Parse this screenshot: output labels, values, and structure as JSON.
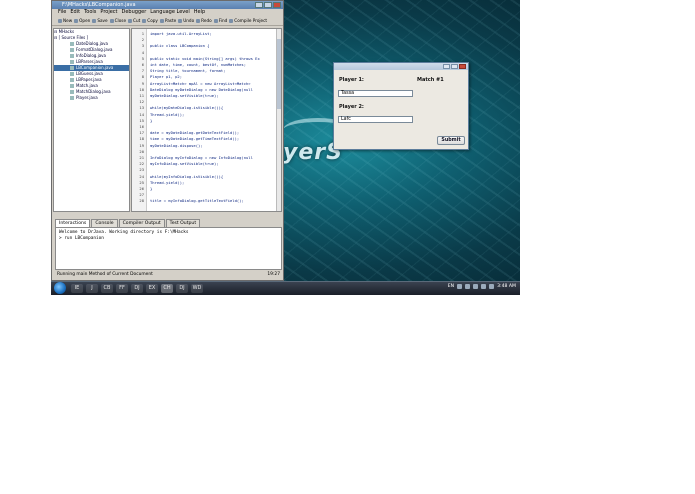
{
  "ide": {
    "title": "F:\\MHacks\\LBCompanion.java",
    "menu": [
      "File",
      "Edit",
      "Tools",
      "Project",
      "Debugger",
      "Language Level",
      "Help"
    ],
    "toolbar": [
      "New",
      "Open",
      "Save",
      "Close",
      "Cut",
      "Copy",
      "Paste",
      "Undo",
      "Redo",
      "Find",
      "Compile Project"
    ],
    "tree": {
      "root": "MHacks",
      "folder": "[ Source Files ]",
      "files": [
        "DateDialog.java",
        "FormatDialog.java",
        "InfoDialog.java",
        "LBParser.java",
        "LBCompanion.java",
        "LBGuess.java",
        "LBPaper.java",
        "Match.java",
        "MatchDialog.java",
        "Player.java"
      ],
      "selected_index": 4
    },
    "code_lines": [
      {
        "n": "1",
        "t": "import java.util.ArrayList;"
      },
      {
        "n": "2",
        "t": ""
      },
      {
        "n": "3",
        "t": "public class LBCompanion {"
      },
      {
        "n": "4",
        "t": ""
      },
      {
        "n": "5",
        "t": "  public static void main(String[] args) throws Ex"
      },
      {
        "n": "6",
        "t": "    int date, time, count, bestOf, numMatches;"
      },
      {
        "n": "7",
        "t": "    String title, tournament, format;"
      },
      {
        "n": "8",
        "t": "    Player p1, p2;"
      },
      {
        "n": "9",
        "t": "    ArrayList<Match> mpAl = new ArrayList<Match>"
      },
      {
        "n": "10",
        "t": "    DateDialog myDateDialog = new DateDialog(null"
      },
      {
        "n": "11",
        "t": "    myDateDialog.setVisible(true);"
      },
      {
        "n": "12",
        "t": ""
      },
      {
        "n": "13",
        "t": "    while(myDateDialog.isVisible()){"
      },
      {
        "n": "14",
        "t": "      Thread.yield();"
      },
      {
        "n": "15",
        "t": "    }"
      },
      {
        "n": "16",
        "t": ""
      },
      {
        "n": "17",
        "t": "    date = myDateDialog.getDateTextField();"
      },
      {
        "n": "18",
        "t": "    time = myDateDialog.getTimeTextField();"
      },
      {
        "n": "19",
        "t": "    myDateDialog.dispose();"
      },
      {
        "n": "20",
        "t": ""
      },
      {
        "n": "21",
        "t": "    InfoDialog myInfoDialog = new InfoDialog(null"
      },
      {
        "n": "22",
        "t": "    myInfoDialog.setVisible(true);"
      },
      {
        "n": "23",
        "t": ""
      },
      {
        "n": "24",
        "t": "    while(myInfoDialog.isVisible()){"
      },
      {
        "n": "25",
        "t": "      Thread.yield();"
      },
      {
        "n": "26",
        "t": "    }"
      },
      {
        "n": "27",
        "t": ""
      },
      {
        "n": "28",
        "t": "    title = myInfoDialog.getTitleTextField();"
      }
    ],
    "tabs": [
      "Interactions",
      "Console",
      "Compiler Output",
      "Test Output"
    ],
    "active_tab": 0,
    "console_lines": [
      "Welcome to DrJava.  Working directory is F:\\MHacks",
      "> run LBCompanion"
    ],
    "status_left": "Running main Method of Current Document",
    "status_right": "19:27"
  },
  "desktop": {
    "logo_text": "yerS"
  },
  "dialog": {
    "player1_label": "Player 1:",
    "match_label": "Match #1",
    "player1_value": "Tassa",
    "player2_label": "Player 2:",
    "player2_value": "Lafc",
    "submit_label": "Submit"
  },
  "taskbar": {
    "apps": [
      "IE",
      "J",
      "CB",
      "FF",
      "DJ",
      "EX",
      "CH",
      "DJ",
      "WD"
    ],
    "active_index": 6,
    "lang": "EN",
    "clock": "3:48 AM"
  }
}
